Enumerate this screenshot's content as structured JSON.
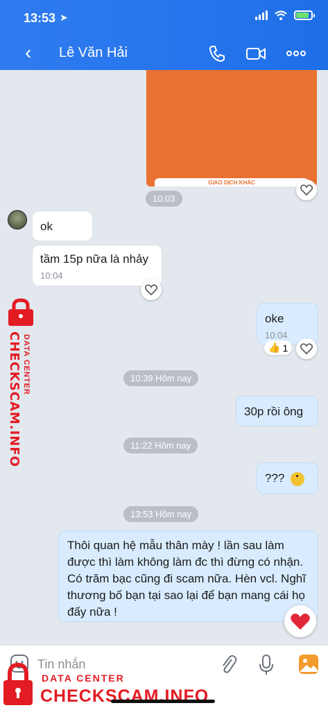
{
  "status_bar": {
    "time": "13:53"
  },
  "header": {
    "back": "‹",
    "contact_name": "Lê Văn Hải"
  },
  "image_message": {
    "caption": "GIAO DỊCH KHÁC",
    "time": "10:03"
  },
  "messages": [
    {
      "text": "ok"
    },
    {
      "text": "tầm 15p nữa là nhảy",
      "time": "10:04"
    },
    {
      "text": "oke",
      "time": "10:04",
      "reaction_count": "1"
    },
    {
      "text": "30p rồi ông"
    },
    {
      "text": "???"
    },
    {
      "text": "Thôi quan hệ mẫu thân mày ! lần sau làm được thì làm không làm đc thì đừng có nhận. Có trăm bạc cũng đi scam nữa. Hèn vcl. Nghĩ thương bố bạn tại sao lại để bạn mang cái họ đấy nữa !"
    }
  ],
  "time_dividers": [
    "10:39 Hôm nay",
    "11:22 Hôm nay",
    "13:53 Hôm nay"
  ],
  "input": {
    "placeholder": "Tin nhắn"
  },
  "watermark": {
    "top": "DATA CENTER",
    "brand": "CHECKSCAM.INFO"
  },
  "colors": {
    "header": "#1e6fe8",
    "out_bubble": "#d9ecff",
    "watermark": "#e31b23",
    "image": "#e97132"
  }
}
